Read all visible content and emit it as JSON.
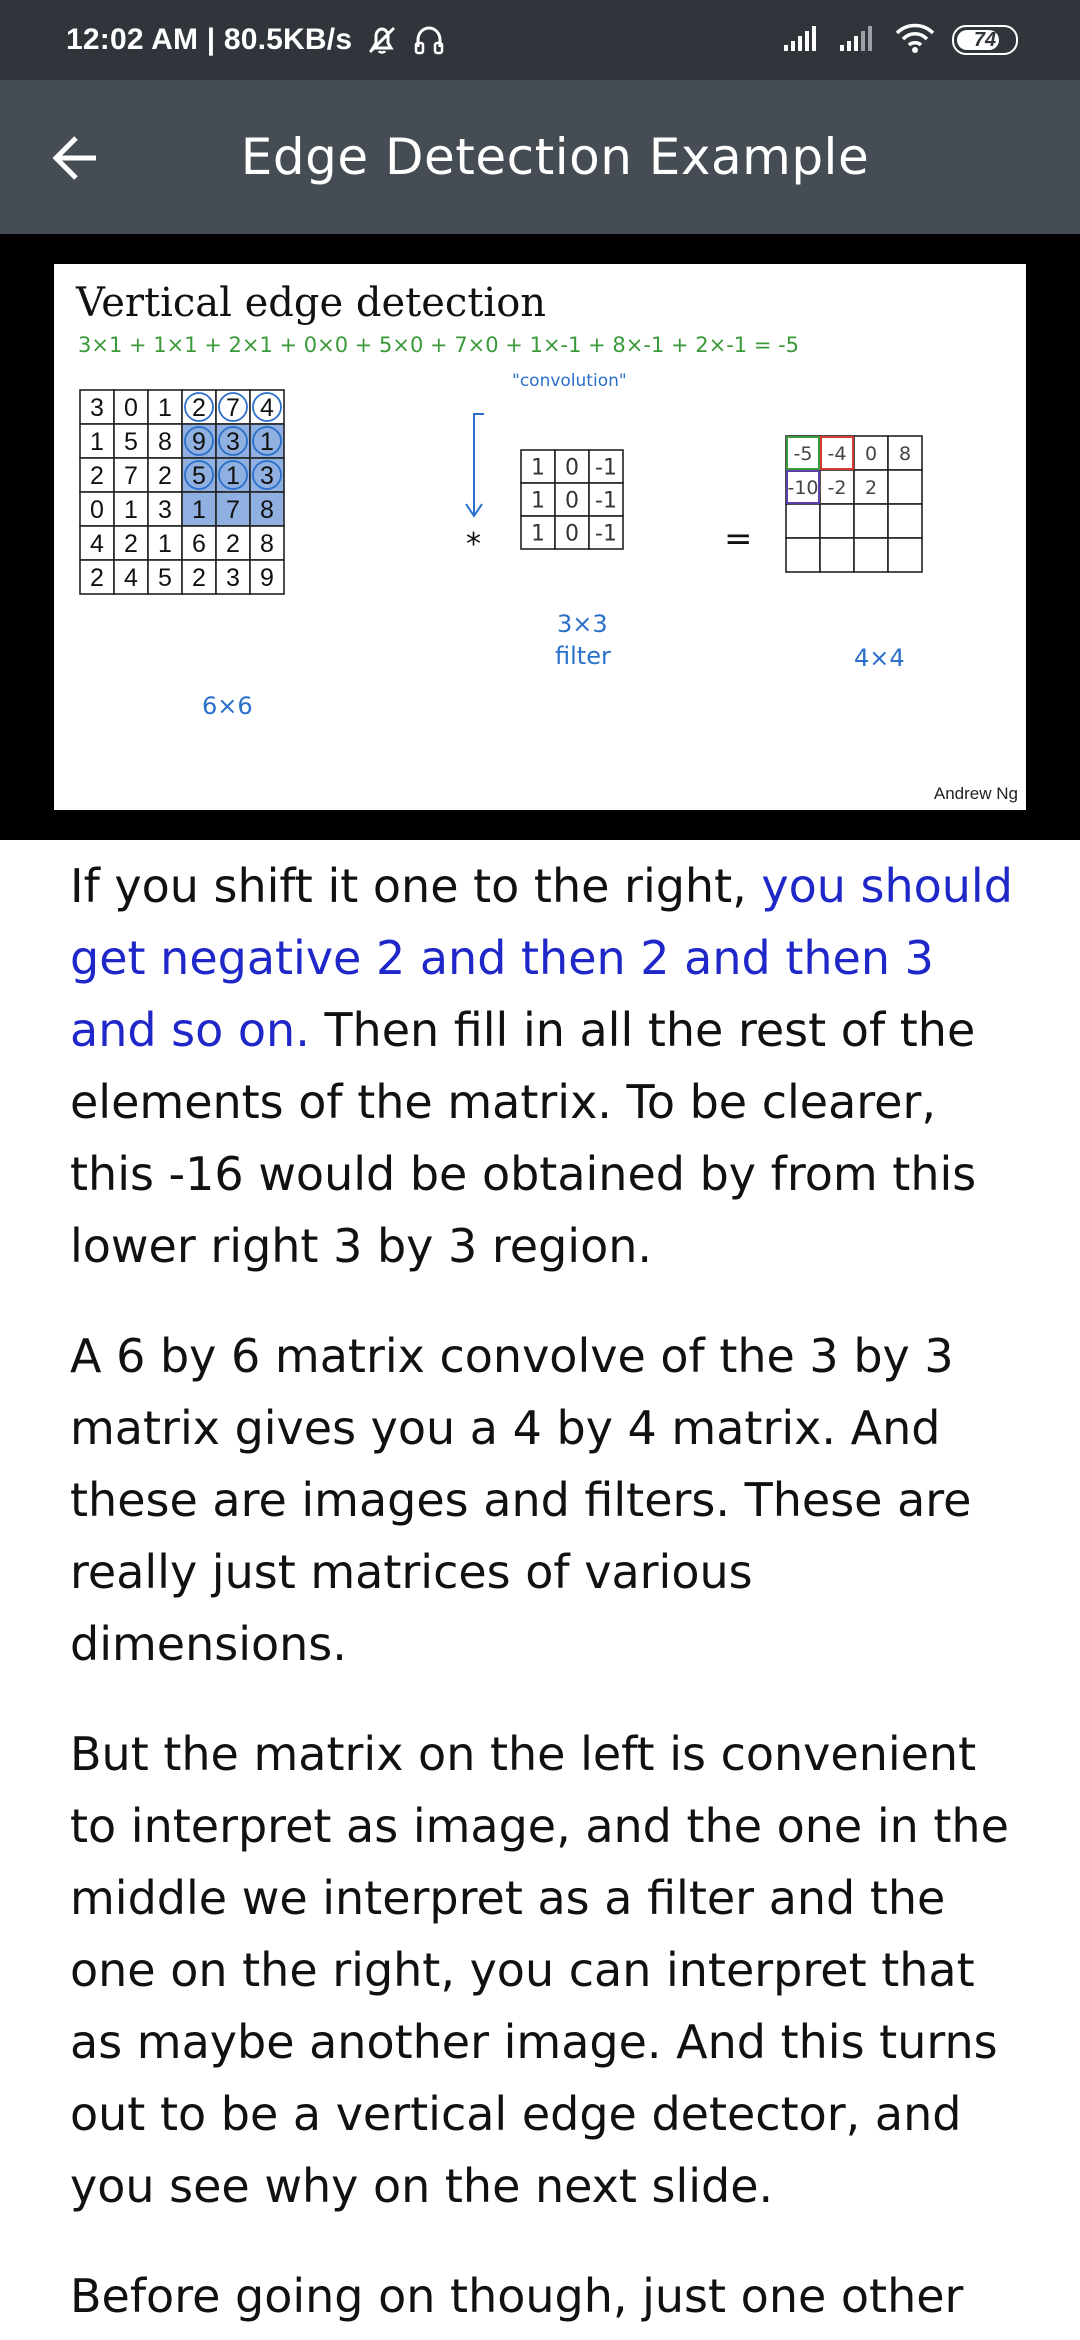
{
  "status_bar": {
    "time_speed": "12:02 AM | 80.5KB/s",
    "battery": "74",
    "icons": [
      "alarm-off-icon",
      "headset-icon",
      "signal-icon",
      "signal-icon",
      "wifi-icon",
      "battery-icon"
    ]
  },
  "app_bar": {
    "title": "Edge Detection Example",
    "back_icon": "arrow-left-icon"
  },
  "slide": {
    "title": "Vertical edge detection",
    "equation": "3×1 + 1×1 + 2×1 + 0×0 + 5×0 + 7×0 + 1×-1 + 8×-1 + 2×-1 = -5",
    "convolution_label": "\"convolution\"",
    "operator_star": "*",
    "operator_equals": "=",
    "image_matrix": [
      [
        "3",
        "0",
        "1",
        "2",
        "7",
        "4"
      ],
      [
        "1",
        "5",
        "8",
        "9",
        "3",
        "1"
      ],
      [
        "2",
        "7",
        "2",
        "5",
        "1",
        "3"
      ],
      [
        "0",
        "1",
        "3",
        "1",
        "7",
        "8"
      ],
      [
        "4",
        "2",
        "1",
        "6",
        "2",
        "8"
      ],
      [
        "2",
        "4",
        "5",
        "2",
        "3",
        "9"
      ]
    ],
    "image_label": "6×6",
    "filter_matrix": [
      [
        "1",
        "0",
        "-1"
      ],
      [
        "1",
        "0",
        "-1"
      ],
      [
        "1",
        "0",
        "-1"
      ]
    ],
    "filter_label_1": "3×3",
    "filter_label_2": "filter",
    "output_matrix": [
      [
        "-5",
        "-4",
        "0",
        "8"
      ],
      [
        "-10",
        "-2",
        "2",
        ""
      ],
      [
        "",
        "",
        "",
        ""
      ],
      [
        "",
        "",
        "",
        ""
      ]
    ],
    "output_label": "4×4",
    "credit": "Andrew Ng",
    "colors": {
      "highlight": "#8fb0e0",
      "ink": "#2a6fc9",
      "red": "#d83a2e",
      "green": "#3b9a3a",
      "purple": "#5b3fa8"
    }
  },
  "transcript": {
    "p1_part1": "If you shift it one to the right, ",
    "p1_highlight": "you should get negative 2 and then 2 and then 3 and so on.",
    "p1_part2": " Then fill in all the rest of the elements of the matrix. To be clearer, this -16 would be obtained by from this lower right 3 by 3 region.",
    "p2": "A 6 by 6 matrix convolve of the 3 by 3 matrix gives you a 4 by 4 matrix. And these are images and filters. These are really just matrices of various dimensions.",
    "p3": "But the matrix on the left is convenient to interpret as image, and the one in the middle we interpret as a filter and the one on the right, you can interpret that as maybe another image. And this turns out to be a vertical edge detector, and you see why on the next slide.",
    "p4": "Before going on though, just one other"
  }
}
